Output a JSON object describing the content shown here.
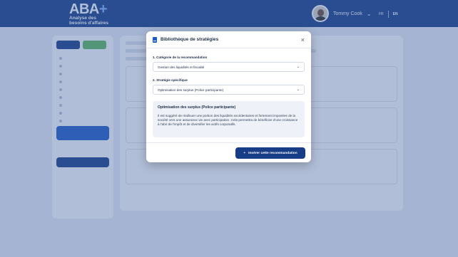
{
  "header": {
    "logo": "ABA",
    "logo_plus": "+",
    "subtitle_line1": "Analyse des",
    "subtitle_line2": "besoins d'affaires",
    "user_name": "Tommy Cook",
    "lang_fr": "FR",
    "lang_en": "EN"
  },
  "modal": {
    "title": "Bibliothèque de stratégies",
    "field1_label": "1. Catégorie de la recommandation",
    "field1_value": "Gestion des liquidités et fiscalité",
    "field2_label": "2. Stratégie spécifique",
    "field2_value": "Optimisation des surplus (Police participante)",
    "desc_title": "Optimisation des surplus (Police participante)",
    "desc_text": "Il est suggéré de réallouer une portion des liquidités excédentaires et fortement imposées de la société vers une assurance vie avec participation. Cela permettra de bénéficier d'une croissance à l'abri de l'impôt et de diversifier les actifs corporatifs.",
    "insert_button": "Insérer cette recommandation"
  },
  "colors": {
    "header_bg": "#163d86",
    "accent": "#1e5bc6",
    "overlay": "rgba(70, 100, 160, 0.42)"
  }
}
